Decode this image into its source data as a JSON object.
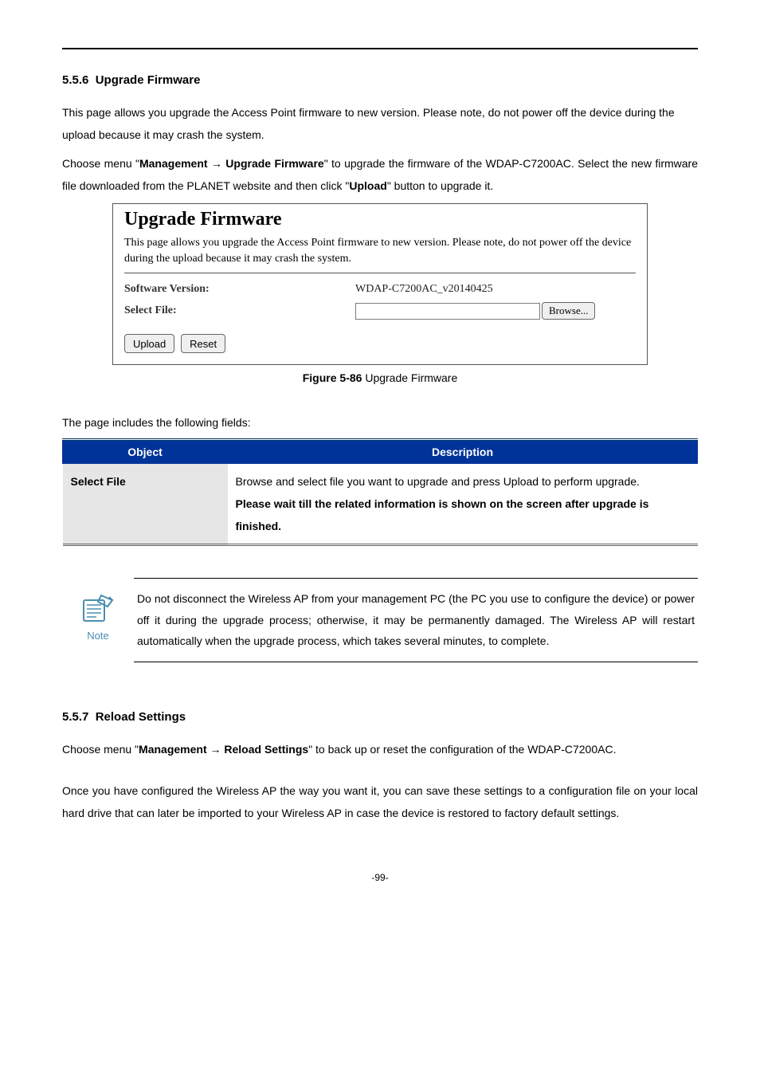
{
  "section1": {
    "number": "5.5.6",
    "title": "Upgrade Firmware",
    "intro1": "This page allows you upgrade the Access Point firmware to new version. Please note, do not power off the device during the upload because it may crash the system.",
    "intro2_pre": "Choose menu \"",
    "intro2_bold1": "Management",
    "intro2_arrow": " → ",
    "intro2_bold2": "Upgrade Firmware",
    "intro2_mid": "\" to upgrade the firmware of the WDAP-C7200AC. Select the new firmware file downloaded from the PLANET website and then click \"",
    "intro2_bold3": "Upload",
    "intro2_post": "\" button to upgrade it."
  },
  "screenshot": {
    "title": "Upgrade Firmware",
    "desc": "This page allows you upgrade the Access Point firmware to new version. Please note, do not power off the device during the upload because it may crash the system.",
    "label_version": "Software Version:",
    "value_version": "WDAP-C7200AC_v20140425",
    "label_selectfile": "Select File:",
    "browse": "Browse...",
    "upload": "Upload",
    "reset": "Reset"
  },
  "figure": {
    "label": "Figure 5-86",
    "caption": " Upgrade Firmware"
  },
  "fields_intro": "The page includes the following fields:",
  "table": {
    "h1": "Object",
    "h2": "Description",
    "row1_c1": "Select File",
    "row1_c2_line1": "Browse and select file you want to upgrade and press Upload to perform upgrade.",
    "row1_c2_line2": "Please wait till the related information is shown on the screen after upgrade is finished."
  },
  "note": {
    "label": "Note",
    "text": "Do not disconnect the Wireless AP from your management PC (the PC you use to configure the device) or power off it during the upgrade process; otherwise, it may be permanently damaged. The Wireless AP will restart automatically when the upgrade process, which takes several minutes, to complete."
  },
  "section2": {
    "number": "5.5.7",
    "title": "Reload Settings",
    "intro1_pre": "Choose menu \"",
    "intro1_bold1": "Management",
    "intro1_arrow": " → ",
    "intro1_bold2": "Reload Settings",
    "intro1_post": "\" to back up or reset the configuration of the WDAP-C7200AC.",
    "intro2": "Once you have configured the Wireless AP the way you want it, you can save these settings to a configuration file on your local hard drive that can later be imported to your Wireless AP in case the device is restored to factory default settings."
  },
  "page_number": "-99-"
}
